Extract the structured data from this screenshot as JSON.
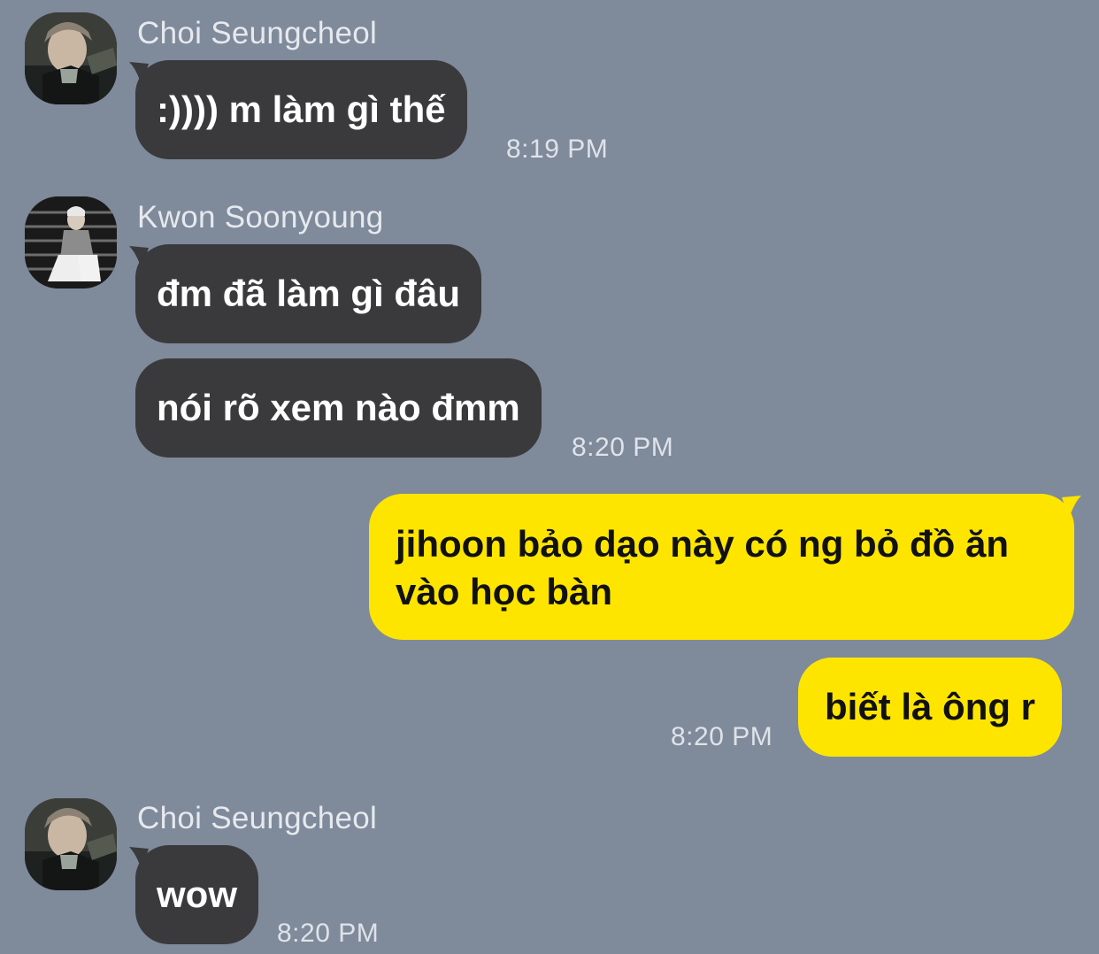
{
  "colors": {
    "background": "#7f8a9b",
    "incoming_bubble": "#3a3a3c",
    "outgoing_bubble": "#fee500"
  },
  "messages": [
    {
      "sender": "Choi Seungcheol",
      "avatar_icon": "profile-photo",
      "bubbles": [
        ":)))) m làm gì thế"
      ],
      "time": "8:19 PM"
    },
    {
      "sender": "Kwon Soonyoung",
      "avatar_icon": "profile-photo",
      "bubbles": [
        "đm đã làm gì đâu",
        "nói rõ xem nào đmm"
      ],
      "time": "8:20 PM"
    },
    {
      "sender": "",
      "outgoing": true,
      "bubbles": [
        "jihoon bảo dạo này có ng bỏ đồ ăn\nvào học bàn",
        "biết là ông r"
      ],
      "bubble_lines": [
        "jihoon bảo dạo này có ng bỏ đồ ăn",
        "vào học bàn"
      ],
      "time": "8:20 PM"
    },
    {
      "sender": "Choi Seungcheol",
      "avatar_icon": "profile-photo",
      "bubbles": [
        "wow"
      ],
      "time": "8:20 PM"
    }
  ]
}
